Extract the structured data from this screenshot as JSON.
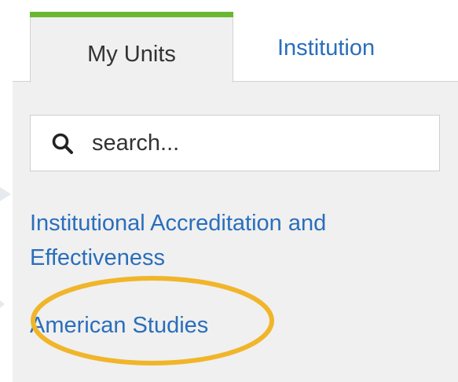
{
  "tabs": [
    {
      "label": "My Units",
      "active": true
    },
    {
      "label": "Institution",
      "active": false
    }
  ],
  "search": {
    "placeholder": "search..."
  },
  "units": [
    {
      "label": "Institutional Accreditation and Effectiveness"
    },
    {
      "label": "American Studies",
      "highlighted": true
    }
  ],
  "colors": {
    "accent_green": "#6ab832",
    "link_blue": "#2a6ebb",
    "highlight_gold": "#f1b52a",
    "panel_bg": "#f0f0f0"
  },
  "icons": {
    "search": "search-icon"
  }
}
